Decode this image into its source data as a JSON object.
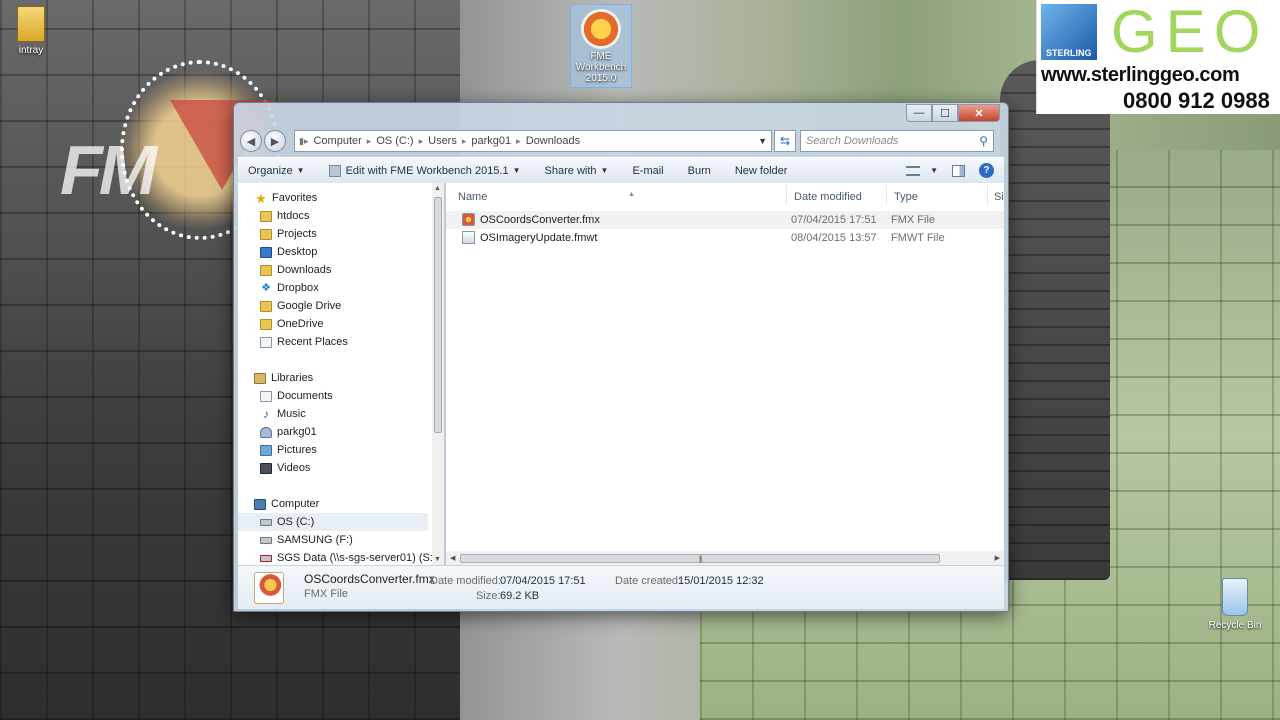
{
  "desktop": {
    "icons": [
      {
        "label": "intray"
      },
      {
        "label": "FME Workbench 2015.0"
      },
      {
        "label": "Recycle Bin"
      }
    ],
    "watermark": {
      "text": "FM"
    }
  },
  "banner": {
    "logo_text": "STERLING",
    "geo_text": "GEO",
    "url": "www.sterlinggeo.com",
    "phone": "0800 912 0988",
    "accent_color": "#a4d65e"
  },
  "window": {
    "controls": {
      "minimize": "—",
      "maximize": "☐",
      "close": "✕"
    },
    "breadcrumb": [
      "Computer",
      "OS (C:)",
      "Users",
      "parkg01",
      "Downloads"
    ],
    "search_placeholder": "Search Downloads",
    "toolbar": {
      "organize": "Organize",
      "edit_with": "Edit with FME Workbench 2015.1",
      "share_with": "Share with",
      "email": "E-mail",
      "burn": "Burn",
      "new_folder": "New folder"
    },
    "nav": {
      "favorites_label": "Favorites",
      "favorites": [
        "htdocs",
        "Projects",
        "Desktop",
        "Downloads",
        "Dropbox",
        "Google Drive",
        "OneDrive",
        "Recent Places"
      ],
      "libraries_label": "Libraries",
      "libraries": [
        "Documents",
        "Music",
        "parkg01",
        "Pictures",
        "Videos"
      ],
      "computer_label": "Computer",
      "computer": [
        "OS (C:)",
        "SAMSUNG (F:)",
        "SGS Data (\\\\s-sgs-server01) (S:)"
      ]
    },
    "columns": {
      "name": "Name",
      "date": "Date modified",
      "type": "Type",
      "size": "Si"
    },
    "files": [
      {
        "name": "OSCoordsConverter.fmx",
        "date": "07/04/2015 17:51",
        "type": "FMX File"
      },
      {
        "name": "OSImageryUpdate.fmwt",
        "date": "08/04/2015 13:57",
        "type": "FMWT File"
      }
    ],
    "details": {
      "name": "OSCoordsConverter.fmx",
      "type": "FMX File",
      "date_modified_label": "Date modified:",
      "date_modified": "07/04/2015 17:51",
      "date_created_label": "Date created:",
      "date_created": "15/01/2015 12:32",
      "size_label": "Size:",
      "size": "69.2 KB"
    }
  }
}
